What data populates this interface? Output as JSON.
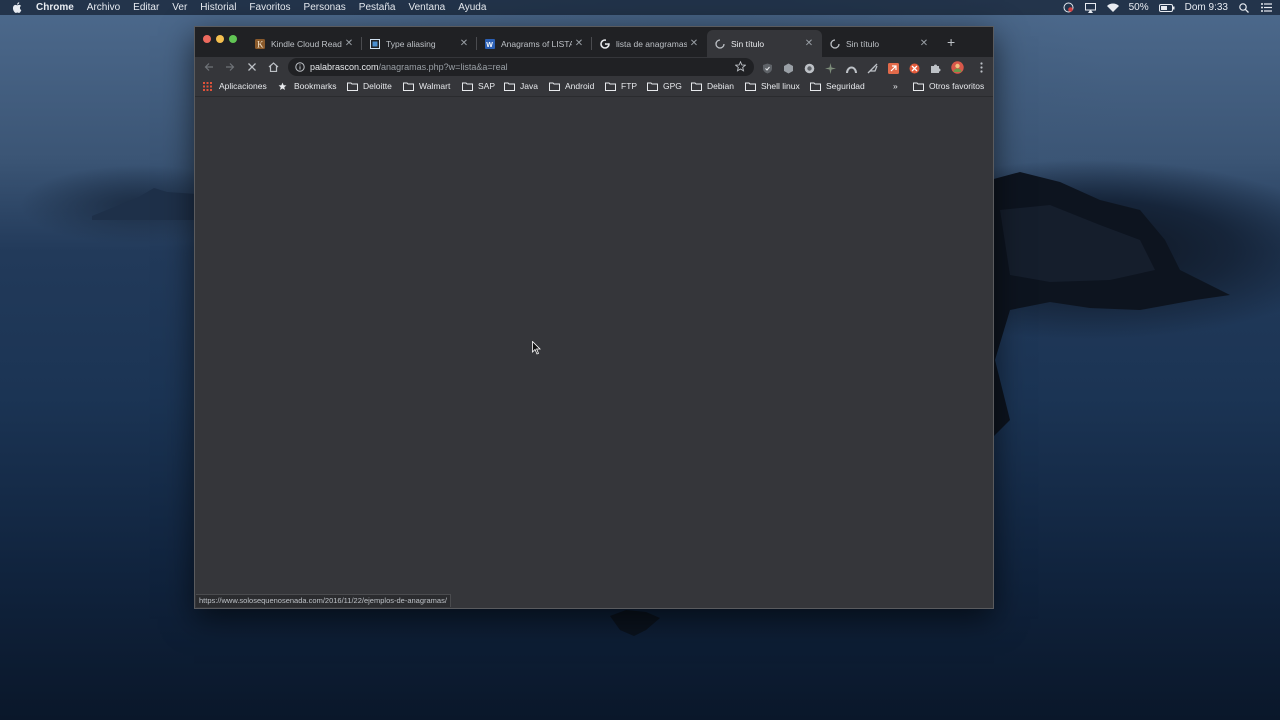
{
  "menubar": {
    "app_name": "Chrome",
    "items": [
      "Archivo",
      "Editar",
      "Ver",
      "Historial",
      "Favoritos",
      "Personas",
      "Pestaña",
      "Ventana",
      "Ayuda"
    ],
    "battery": "50%",
    "clock": "Dom 9:33"
  },
  "tabs": [
    {
      "title": "Kindle Cloud Reader",
      "icon": "kindle-icon"
    },
    {
      "title": "Type aliasing",
      "icon": "document-icon"
    },
    {
      "title": "Anagrams of LISTA",
      "icon": "word-icon"
    },
    {
      "title": "lista de anagramas",
      "icon": "google-icon"
    },
    {
      "title": "Sin título",
      "icon": "loading-spinner-icon",
      "active": true
    },
    {
      "title": "Sin título",
      "icon": "loading-spinner-icon"
    }
  ],
  "address_bar": {
    "host": "palabrascon.com",
    "path": "/anagramas.php?w=lista&a=real"
  },
  "bookmarks": [
    {
      "label": "Aplicaciones",
      "icon": "apps-grid-icon"
    },
    {
      "label": "Bookmarks",
      "icon": "star-icon"
    },
    {
      "label": "Deloitte",
      "icon": "folder-icon"
    },
    {
      "label": "Walmart",
      "icon": "folder-icon"
    },
    {
      "label": "SAP",
      "icon": "folder-icon"
    },
    {
      "label": "Java",
      "icon": "folder-icon"
    },
    {
      "label": "Android",
      "icon": "folder-icon"
    },
    {
      "label": "FTP",
      "icon": "folder-icon"
    },
    {
      "label": "GPG",
      "icon": "folder-icon"
    },
    {
      "label": "Debian",
      "icon": "folder-icon"
    },
    {
      "label": "Shell linux",
      "icon": "folder-icon"
    },
    {
      "label": "Seguridad",
      "icon": "folder-icon"
    }
  ],
  "overflow_chevron": "»",
  "other_bookmarks": "Otros favoritos",
  "status_url": "https://www.solosequenosenada.com/2016/11/22/ejemplos-de-anagramas/",
  "colors": {
    "tab_strip": "#202124",
    "toolbar": "#35363a",
    "traffic_red": "#ed6a5e",
    "traffic_yellow": "#f4bf4f",
    "traffic_green": "#61c554"
  }
}
